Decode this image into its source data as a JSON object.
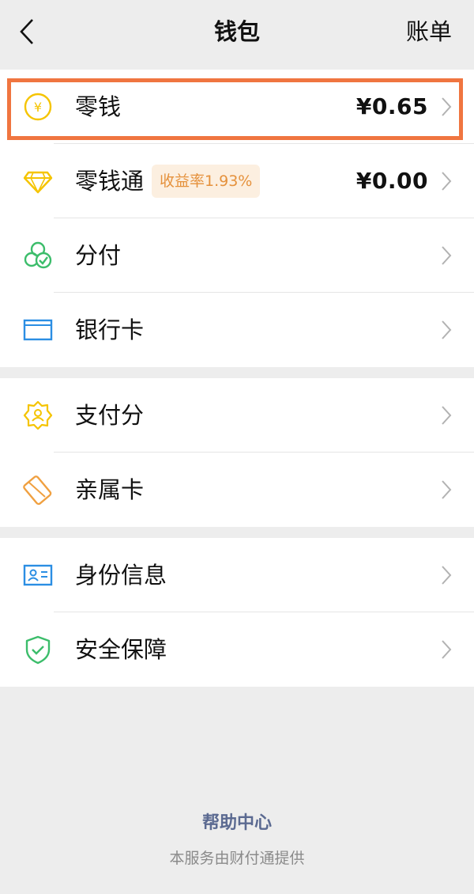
{
  "navbar": {
    "back_icon": "chevron-left-icon",
    "title": "钱包",
    "bill": "账单"
  },
  "groups": [
    {
      "items": [
        {
          "label": "零钱",
          "value": "¥0.65",
          "icon": "yuan-coin-icon",
          "color": "#f5c400"
        },
        {
          "label": "零钱通",
          "value": "¥0.00",
          "badge": "收益率1.93%",
          "icon": "diamond-icon",
          "color": "#f5c400"
        },
        {
          "label": "分付",
          "icon": "clover-check-icon",
          "color": "#3cbd6b"
        },
        {
          "label": "银行卡",
          "icon": "bank-card-icon",
          "color": "#2b8ee3"
        }
      ]
    },
    {
      "items": [
        {
          "label": "支付分",
          "icon": "badge-person-icon",
          "color": "#f5c400"
        },
        {
          "label": "亲属卡",
          "icon": "family-card-icon",
          "color": "#f0a040"
        }
      ]
    },
    {
      "items": [
        {
          "label": "身份信息",
          "icon": "id-card-icon",
          "color": "#2b8ee3"
        },
        {
          "label": "安全保障",
          "icon": "shield-check-icon",
          "color": "#3cbd6b"
        }
      ]
    }
  ],
  "footer": {
    "help": "帮助中心",
    "note": "本服务由财付通提供"
  },
  "colors": {
    "highlight_border": "#f07540",
    "badge_text": "#e5913c",
    "badge_bg": "#fcefe0",
    "link": "#5b6a91"
  }
}
